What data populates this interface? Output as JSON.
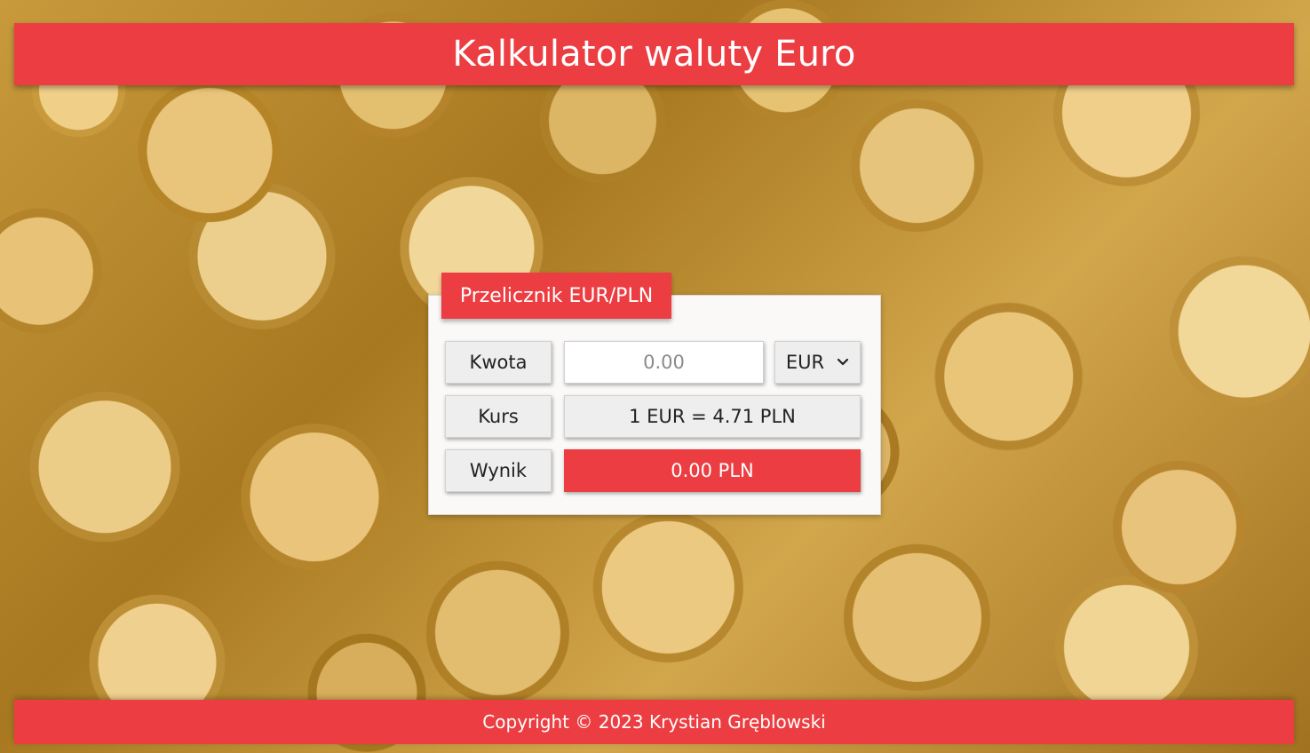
{
  "header": {
    "title": "Kalkulator waluty Euro"
  },
  "converter": {
    "tab_label": "Przelicznik EUR/PLN",
    "amount_label": "Kwota",
    "amount_placeholder": "0.00",
    "amount_value": "",
    "currency": {
      "selected": "EUR",
      "icon": "chevron-down-icon"
    },
    "rate_label": "Kurs",
    "rate_value": "1 EUR = 4.71 PLN",
    "result_label": "Wynik",
    "result_value": "0.00 PLN"
  },
  "footer": {
    "text": "Copyright © 2023 Krystian Gręblowski"
  },
  "colors": {
    "accent": "#ec3e42",
    "panel": "#faf9f8",
    "field": "#eeeeee"
  }
}
